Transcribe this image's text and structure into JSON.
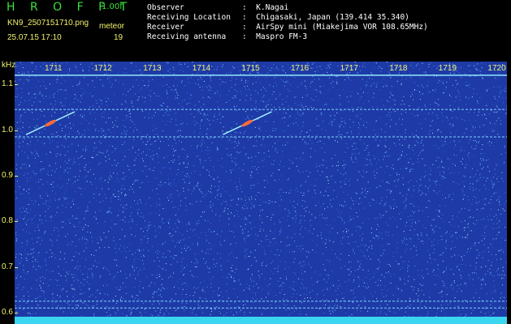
{
  "header": {
    "logo": "H R O F F T",
    "version": "1.00f",
    "filename": "KN9_2507151710.png",
    "meteor_label": "meteor",
    "date_time": "25.07.15 17:10",
    "meteor_count": "19",
    "info_lines": [
      {
        "label": "Observer",
        "value": ":  K.Nagai"
      },
      {
        "label": "Receiving Location",
        "value": ":  Chigasaki, Japan (139.414 35.340)"
      },
      {
        "label": "Receiver",
        "value": ":  AirSpy mini (Miakejima VOR 108.65MHz)"
      },
      {
        "label": "Receiving antenna",
        "value": ":  Maspro FM-3"
      }
    ]
  },
  "chart_data": {
    "type": "heatmap",
    "title": "",
    "ylabel": "kHz",
    "x_tick_labels": [
      "1711",
      "1712",
      "1713",
      "1714",
      "1715",
      "1716",
      "1717",
      "1718",
      "1719",
      "1720"
    ],
    "y_tick_labels": [
      "1.1",
      "1.0",
      "0.9",
      "0.8",
      "0.7",
      "0.6"
    ],
    "y_tick_values": [
      1.1,
      1.0,
      0.9,
      0.8,
      0.7,
      0.6
    ],
    "ylim": [
      0.575,
      1.15
    ],
    "horizontal_lines_khz": [
      1.12,
      1.045,
      0.985,
      0.625,
      0.61
    ],
    "meteor_echoes": [
      {
        "x_min": "1711",
        "start_khz": 0.99,
        "end_khz": 1.04
      },
      {
        "x_min": "1715",
        "start_khz": 0.99,
        "end_khz": 1.04
      }
    ],
    "colors": {
      "background": "#1e3aa6",
      "noise": "#4aa0ff",
      "line": "#8fe8ff",
      "echo": "#ff6a3a"
    }
  }
}
